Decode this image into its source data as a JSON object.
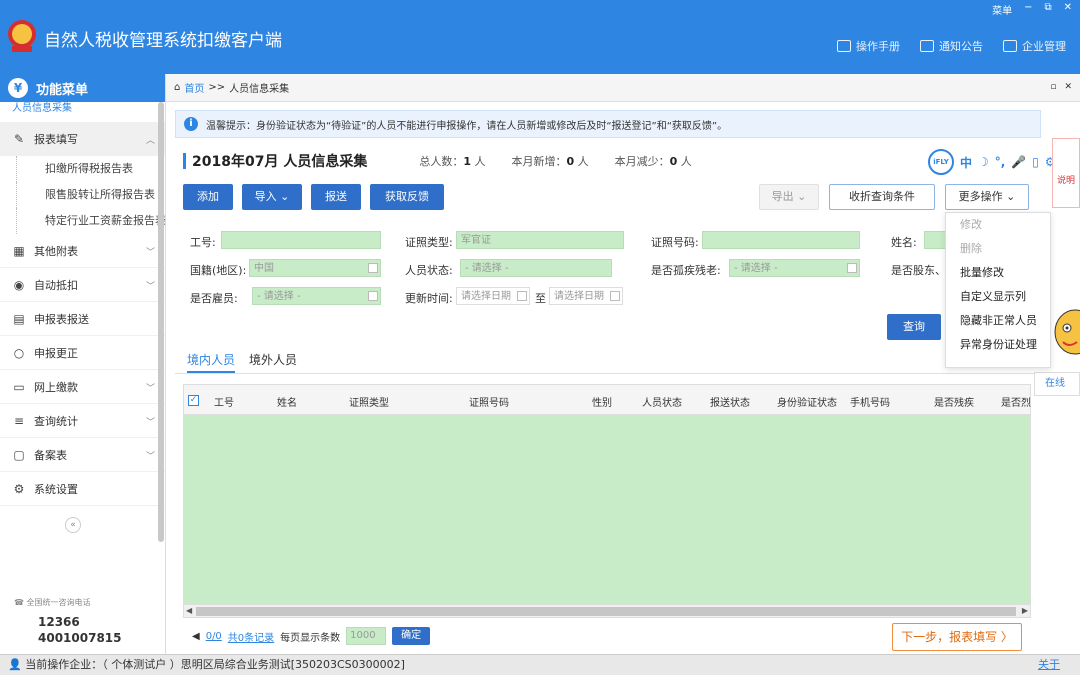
{
  "window": {
    "title": "自然人税收管理系统扣缴客户端",
    "controls": {
      "menu": "菜单",
      "minimize": "−",
      "restore": "⧉",
      "close": "✕"
    },
    "top_links": [
      "操作手册",
      "通知公告",
      "企业管理"
    ],
    "brand_color": "#2f86e2"
  },
  "sidebar": {
    "header": "功能菜单",
    "cut_item": "人员信息采集",
    "items": [
      {
        "label": "报表填写",
        "icon": "edit-icon",
        "expanded": true,
        "children": [
          "扣缴所得税报告表",
          "限售股转让所得报告表",
          "特定行业工资薪金报告表"
        ]
      },
      {
        "label": "其他附表",
        "icon": "grid-icon"
      },
      {
        "label": "自动抵扣",
        "icon": "auto-deduct-icon"
      },
      {
        "label": "申报表报送",
        "icon": "submit-icon"
      },
      {
        "label": "申报更正",
        "icon": "search-icon"
      },
      {
        "label": "网上缴款",
        "icon": "folder-icon"
      },
      {
        "label": "查询统计",
        "icon": "stats-icon"
      },
      {
        "label": "备案表",
        "icon": "file-icon"
      },
      {
        "label": "系统设置",
        "icon": "gear-icon"
      }
    ],
    "collapse": "«",
    "hotline_label": "全国统一咨询电话",
    "hotline_1": "12366",
    "hotline_2": "4001007815"
  },
  "breadcrumb": {
    "home": "首页",
    "sep": ">>",
    "current": "人员信息采集",
    "min": "▫",
    "close": "✕"
  },
  "tip": {
    "icon": "i",
    "text": "温馨提示：身份验证状态为“待验证”的人员不能进行申报操作，请在人员新增或修改后及时“报送登记”和“获取反馈”。"
  },
  "header": {
    "title": "2018年07月  人员信息采集",
    "total_label": "总人数：",
    "total": "1",
    "total_unit": "人",
    "new_label": "本月新增：",
    "new": "0",
    "new_unit": "人",
    "reduce_label": "本月减少：",
    "reduce": "0",
    "reduce_unit": "人"
  },
  "toolbar": {
    "add": "添加",
    "import": "导入",
    "import_chev": "⌄",
    "submit": "报送",
    "feedback": "获取反馈",
    "export": "导出",
    "export_chev": "⌄",
    "collapse_query": "收折查询条件",
    "more": "更多操作",
    "more_chev": "⌄"
  },
  "ifly": {
    "logo": "iFLY",
    "icons": [
      "中",
      "☽",
      "°,",
      "🎤",
      "▯",
      "⚙"
    ]
  },
  "more_menu": [
    {
      "label": "修改",
      "disabled": true
    },
    {
      "label": "删除",
      "disabled": true
    },
    {
      "label": "批量修改",
      "disabled": false
    },
    {
      "label": "自定义显示列",
      "disabled": false
    },
    {
      "label": "隐藏非正常人员",
      "disabled": false
    },
    {
      "label": "异常身份证处理",
      "disabled": false
    }
  ],
  "form": {
    "employee_no": {
      "label": "工号:",
      "value": ""
    },
    "id_type": {
      "label": "证照类型:",
      "value": "军官证"
    },
    "id_number": {
      "label": "证照号码:",
      "value": ""
    },
    "name": {
      "label": "姓名:",
      "value": ""
    },
    "nationality": {
      "label": "国籍(地区):",
      "value": "中国"
    },
    "status": {
      "label": "人员状态:",
      "value": "- 请选择 -"
    },
    "orphan": {
      "label": "是否孤疾残老:",
      "value": "- 请选择 -"
    },
    "shareholder": {
      "label": "是否股东、",
      "value": ""
    },
    "employed": {
      "label": "是否雇员:",
      "value": "- 请选择 -"
    },
    "update_time": {
      "label": "更新时间:",
      "from": "请选择日期",
      "to_label": "至",
      "to": "请选择日期"
    },
    "query": "查询"
  },
  "tabs": [
    "境内人员",
    "境外人员"
  ],
  "table": {
    "columns": [
      "工号",
      "姓名",
      "证照类型",
      "证照号码",
      "性别",
      "人员状态",
      "报送状态",
      "身份验证状态",
      "手机号码",
      "是否残疾",
      "是否烈"
    ],
    "rows": [],
    "check_mark": "✓",
    "scroll_left": "◀",
    "scroll_right": "▶"
  },
  "pager": {
    "page": "0/0",
    "total": "共0条记录",
    "per_page_label": "每页显示条数",
    "per_page": "1000",
    "ok": "确定"
  },
  "next_step": "下一步，报表填写 〉",
  "status": {
    "text": "当前操作企业：（ 个体测试户 ）思明区局综合业务测试[350203CS0300002]",
    "about": "关于"
  },
  "right_panel": {
    "text": "说明",
    "online": "在线"
  }
}
